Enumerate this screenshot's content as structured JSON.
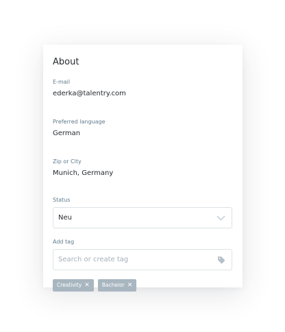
{
  "card": {
    "title": "About",
    "email": {
      "label": "E-mail",
      "value": "ederka@talentry.com"
    },
    "language": {
      "label": "Preferred language",
      "value": "German"
    },
    "location": {
      "label": "Zip or City",
      "value": "Munich, Germany"
    },
    "status": {
      "label": "Status",
      "value": "Neu",
      "icon": "chevron-down-icon"
    },
    "add_tag": {
      "label": "Add tag",
      "placeholder": "Search or create tag",
      "icon": "tag-icon"
    },
    "tags": [
      {
        "label": "Creativity",
        "remove": "✕"
      },
      {
        "label": "Bachelor",
        "remove": "✕"
      }
    ]
  },
  "colors": {
    "label": "#5f7a8c",
    "tag_bg": "#a8b6c0",
    "border": "#dde2e6",
    "icon": "#b5c0c8"
  }
}
